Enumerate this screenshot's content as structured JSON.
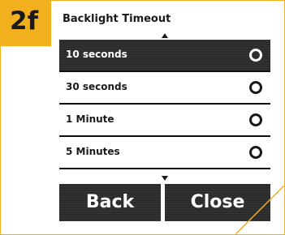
{
  "step": {
    "label": "2f"
  },
  "screen": {
    "title": "Backlight Timeout",
    "options": [
      {
        "label": "10 seconds",
        "selected": true
      },
      {
        "label": "30 seconds",
        "selected": false
      },
      {
        "label": "1 Minute",
        "selected": false
      },
      {
        "label": "5 Minutes",
        "selected": false
      }
    ],
    "buttons": {
      "back": "Back",
      "close": "Close"
    }
  },
  "colors": {
    "accent": "#f2b01e",
    "dark": "#2b2b2b",
    "text": "#1a1a1a",
    "background": "#ffffff"
  }
}
